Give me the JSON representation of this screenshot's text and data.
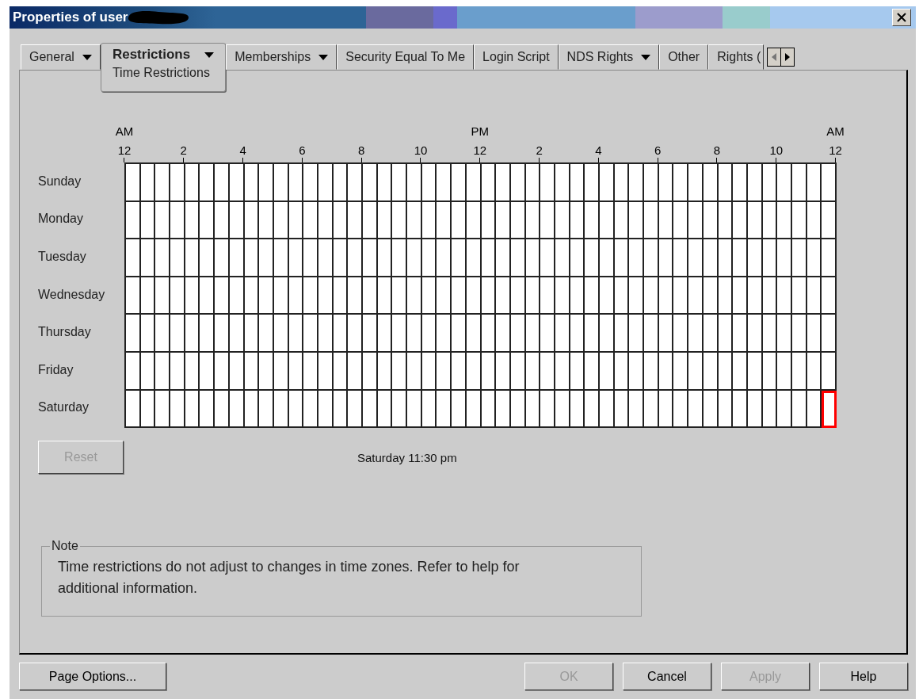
{
  "window": {
    "title": "Properties of user",
    "title_redacted": true
  },
  "tabs": [
    {
      "label": "General",
      "dropdown": true,
      "selected": false
    },
    {
      "label": "Restrictions",
      "dropdown": true,
      "selected": true,
      "subpage": "Time Restrictions"
    },
    {
      "label": "Memberships",
      "dropdown": true,
      "selected": false
    },
    {
      "label": "Security Equal To Me",
      "dropdown": false,
      "selected": false
    },
    {
      "label": "Login Script",
      "dropdown": false,
      "selected": false
    },
    {
      "label": "NDS Rights",
      "dropdown": true,
      "selected": false
    },
    {
      "label": "Other",
      "dropdown": false,
      "selected": false
    },
    {
      "label": "Rights (",
      "dropdown": false,
      "selected": false
    }
  ],
  "schedule": {
    "hours": [
      {
        "hour": "12",
        "period": "AM"
      },
      {
        "hour": "2"
      },
      {
        "hour": "4"
      },
      {
        "hour": "6"
      },
      {
        "hour": "8"
      },
      {
        "hour": "10"
      },
      {
        "hour": "12",
        "period": "PM"
      },
      {
        "hour": "2"
      },
      {
        "hour": "4"
      },
      {
        "hour": "6"
      },
      {
        "hour": "8"
      },
      {
        "hour": "10"
      },
      {
        "hour": "12",
        "period": "AM"
      }
    ],
    "days": [
      {
        "label": "Sunday",
        "focused": false
      },
      {
        "label": "Monday",
        "focused": false
      },
      {
        "label": "Tuesday",
        "focused": false
      },
      {
        "label": "Wednesday",
        "focused": false
      },
      {
        "label": "Thursday",
        "focused": false
      },
      {
        "label": "Friday",
        "focused": false
      },
      {
        "label": "Saturday",
        "focused": true
      }
    ],
    "reset": {
      "label": "Reset",
      "disabled": true
    },
    "status": "Saturday 11:30 pm"
  },
  "note": {
    "legend": "Note",
    "text": "Time restrictions do not adjust to changes in time zones.  Refer to help for additional information."
  },
  "buttons": [
    {
      "label": "Page Options...",
      "disabled": false
    },
    {
      "label": "OK",
      "disabled": true
    },
    {
      "label": "Cancel",
      "disabled": false
    },
    {
      "label": "Apply",
      "disabled": true
    },
    {
      "label": "Help",
      "disabled": false
    }
  ]
}
